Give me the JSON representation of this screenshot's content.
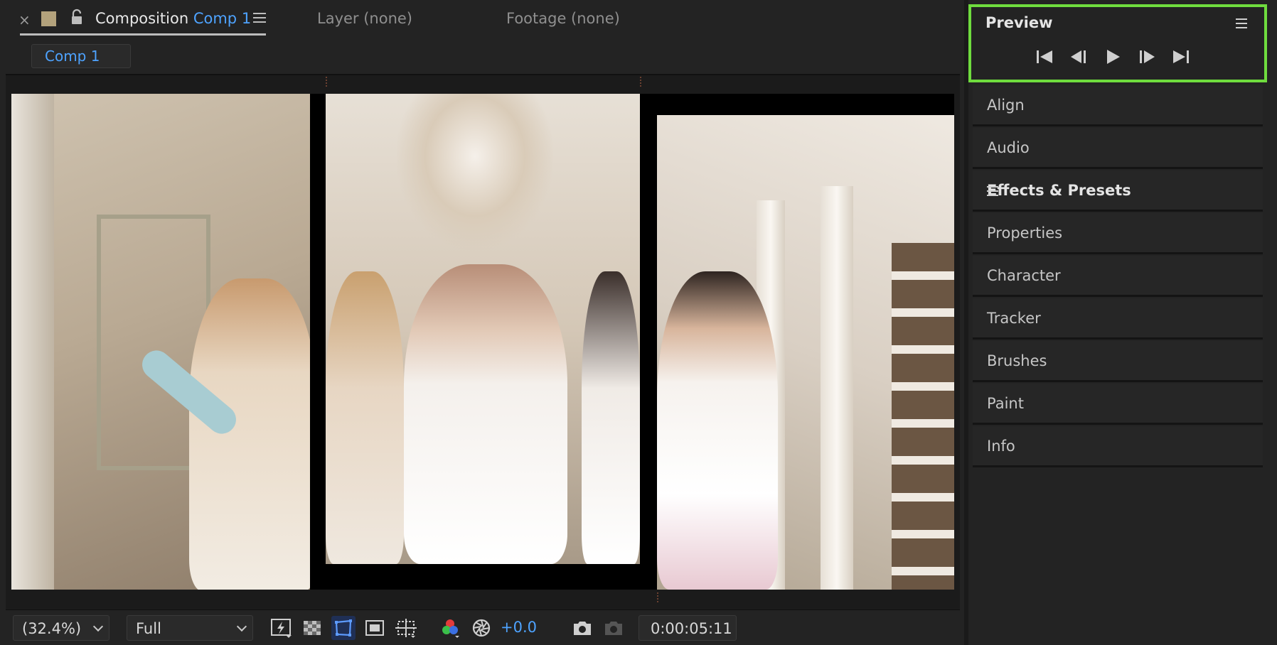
{
  "comp_panel": {
    "close_glyph": "×",
    "tab_prefix": "Composition",
    "tab_comp_name": "Comp 1",
    "layer_tab": "Layer (none)",
    "footage_tab": "Footage (none)",
    "breadcrumb": "Comp 1"
  },
  "viewer_toolbar": {
    "zoom": "(32.4%)",
    "resolution": "Full",
    "exposure": "+0.0",
    "timecode": "0:00:05:11"
  },
  "panels": {
    "preview": "Preview",
    "align": "Align",
    "audio": "Audio",
    "effects": "Effects & Presets",
    "properties": "Properties",
    "character": "Character",
    "tracker": "Tracker",
    "brushes": "Brushes",
    "paint": "Paint",
    "info": "Info"
  },
  "colors": {
    "accent_blue": "#4ea3ff",
    "highlight_green": "#6fdc3e",
    "label_swatch": "#b3a27c"
  }
}
